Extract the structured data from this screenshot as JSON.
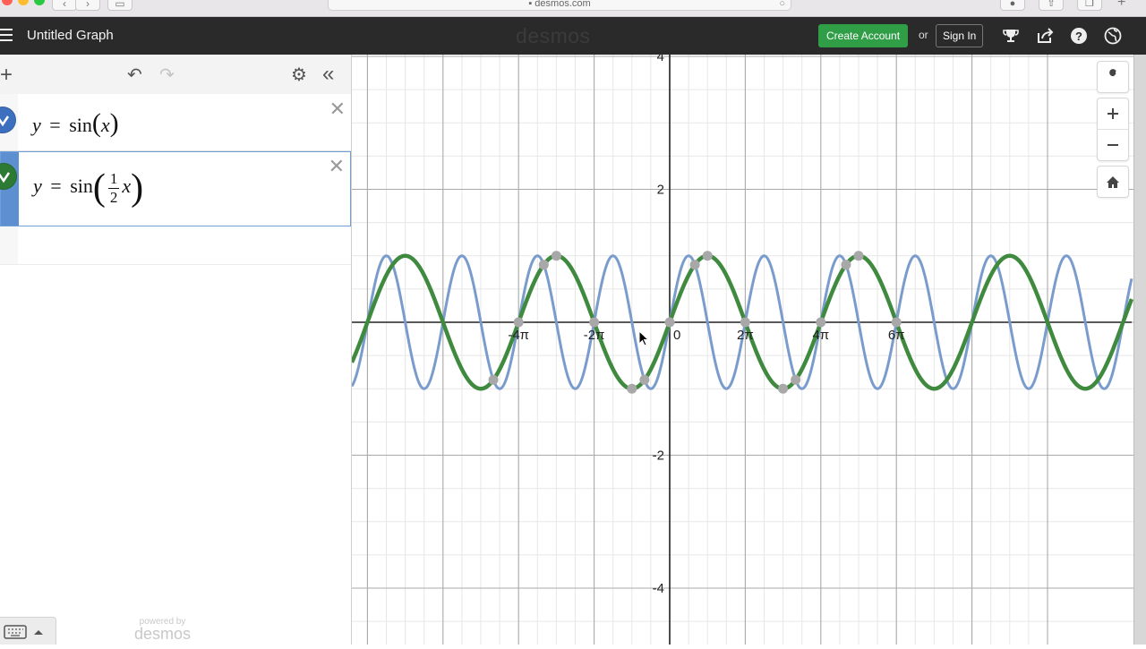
{
  "browser": {
    "url": "desmos.com"
  },
  "header": {
    "title": "Untitled Graph",
    "logo": "desmos",
    "create_account": "Create Account",
    "or_text": "or",
    "sign_in": "Sign In"
  },
  "expressions": [
    {
      "id": 1,
      "latex": "y=sin(x)",
      "color": "#5b83c2",
      "lhs": "y",
      "eq": "=",
      "fn": "sin",
      "arg": "x"
    },
    {
      "id": 2,
      "latex": "y=sin(1/2 x)",
      "color": "#2d7a35",
      "lhs": "y",
      "eq": "=",
      "fn": "sin",
      "num": "1",
      "den": "2",
      "arg": "x",
      "selected": true
    }
  ],
  "footer": {
    "powered_by": "powered by",
    "brand": "desmos"
  },
  "graph": {
    "x_tick_labels": [
      "-4π",
      "-2π",
      "0",
      "2π",
      "4π",
      "6π"
    ],
    "y_tick_labels": [
      "4",
      "2",
      "-2",
      "-4"
    ],
    "colors": {
      "blue": "#7a9ccd",
      "green": "#3f8a3f",
      "grid_minor": "#e7e7e7",
      "grid_major": "#a9a9a9",
      "axis": "#222222",
      "point": "#a8a8a8"
    }
  }
}
